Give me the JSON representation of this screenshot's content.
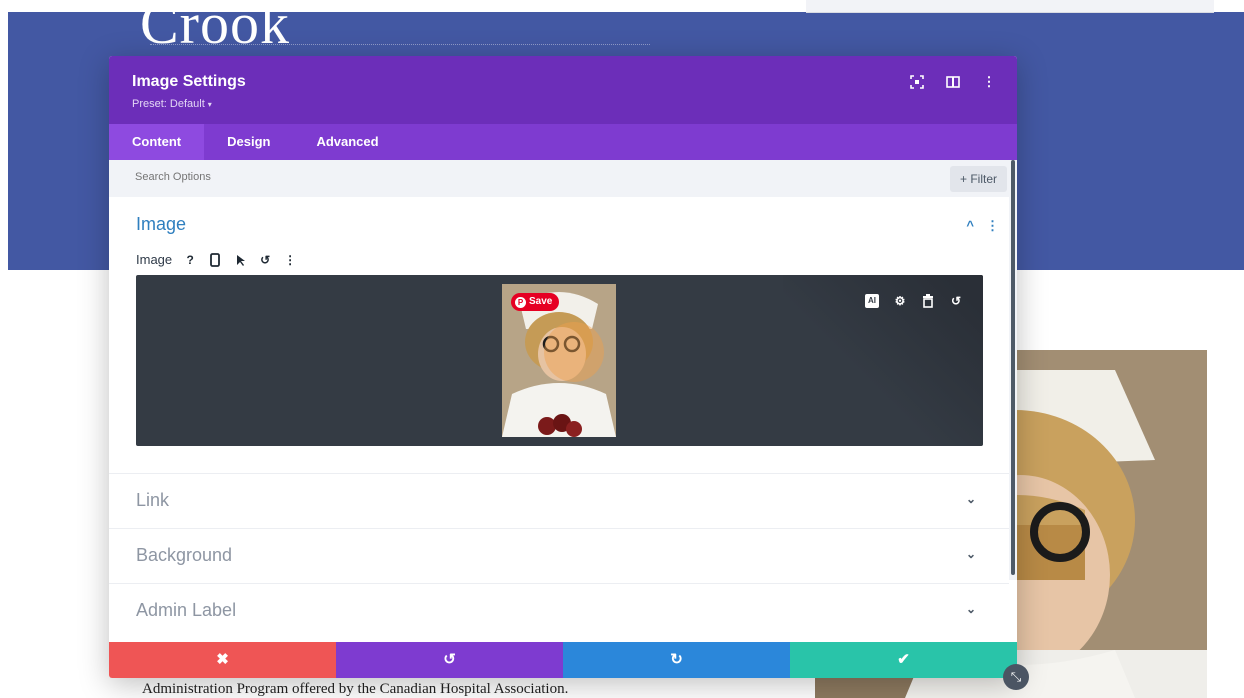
{
  "page": {
    "hero_title": "Crook",
    "body_text": "Administration Program offered by the Canadian Hospital Association."
  },
  "modal": {
    "title": "Image Settings",
    "preset": "Preset: Default",
    "header_icons": [
      "fullscreen-icon",
      "sidebar-toggle-icon",
      "more-options-icon"
    ],
    "tabs": [
      {
        "label": "Content",
        "active": true
      },
      {
        "label": "Design",
        "active": false
      },
      {
        "label": "Advanced",
        "active": false
      }
    ],
    "search": {
      "placeholder": "Search Options",
      "filter_label": "+ Filter"
    },
    "image_section": {
      "title": "Image",
      "field_label": "Image",
      "pin_label": "Save",
      "field_icons": [
        "help-icon",
        "mobile-icon",
        "pointer-icon",
        "reset-icon",
        "more-icon"
      ],
      "uploader_icons": [
        "ai-icon",
        "settings-icon",
        "trash-icon",
        "undo-icon"
      ]
    },
    "sections": [
      {
        "label": "Link"
      },
      {
        "label": "Background"
      },
      {
        "label": "Admin Label"
      }
    ],
    "footer": {
      "cancel": "✖",
      "undo": "↺",
      "redo": "↻",
      "save": "✔"
    }
  },
  "colors": {
    "header": "#6c2eb9",
    "tabs": "#7e3bd0",
    "accent_blue": "#2f7fbf",
    "cancel": "#ef5555",
    "undo": "#7e3bd0",
    "redo": "#2b87da",
    "save": "#29c4a9",
    "hero": "#4358a3"
  }
}
